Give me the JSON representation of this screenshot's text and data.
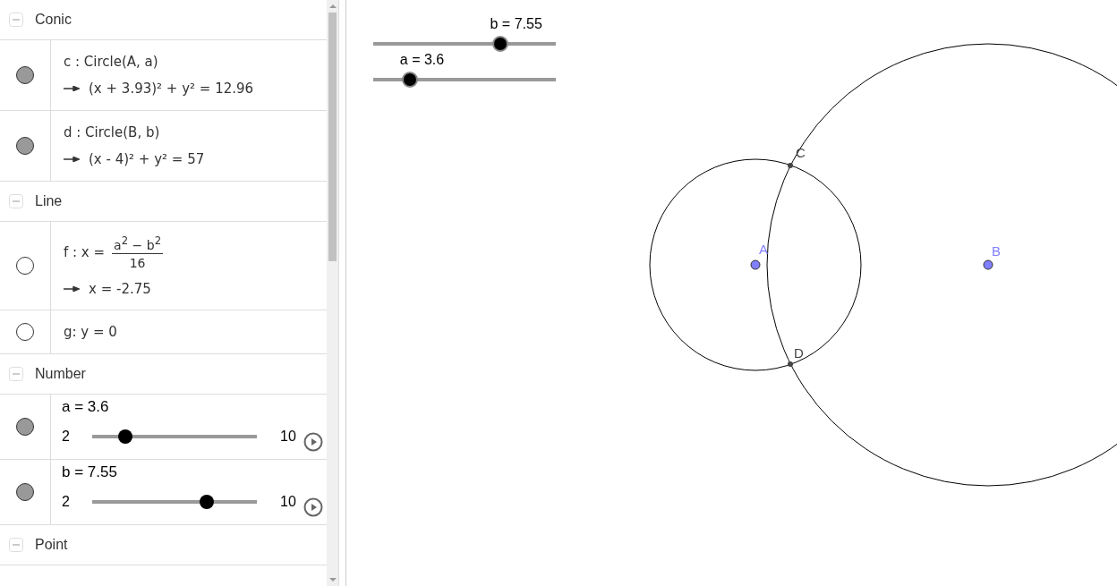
{
  "algebra": {
    "groups": [
      {
        "title": "Conic",
        "expanded": true,
        "items": [
          {
            "kind": "formula",
            "visible": true,
            "definition": "c : Circle(A, a)",
            "value": "(x + 3.93)² + y² = 12.96"
          },
          {
            "kind": "formula",
            "visible": true,
            "definition": "d : Circle(B, b)",
            "value": "(x - 4)² + y² = 57"
          }
        ]
      },
      {
        "title": "Line",
        "expanded": true,
        "items": [
          {
            "kind": "fraction",
            "visible": false,
            "definition": "f : x =",
            "numerator": "a$^{2}$ − b$^{2}$",
            "denominator": "16",
            "value": "x = -2.75"
          },
          {
            "kind": "plain",
            "visible": false,
            "definition": "g: y = 0"
          }
        ]
      },
      {
        "title": "Number",
        "expanded": true,
        "items": [
          {
            "kind": "slider",
            "visible": true,
            "label": "a = 3.6",
            "min": "2",
            "max": "10",
            "level": 0.2
          },
          {
            "kind": "slider",
            "visible": true,
            "label": "b = 7.55",
            "min": "2",
            "max": "10",
            "level": 0.69375
          }
        ]
      },
      {
        "title": "Point",
        "expanded": true
      }
    ]
  },
  "graphics": {
    "sliders": [
      {
        "label": "b = 7.55",
        "level": 0.69375
      },
      {
        "label": "a = 3.6",
        "level": 0.2
      }
    ],
    "points": [
      {
        "label": "A",
        "color": "#7f7fff"
      },
      {
        "label": "B",
        "color": "#7f7fff"
      },
      {
        "label": "C",
        "color": "#444444"
      },
      {
        "label": "D",
        "color": "#444444"
      }
    ]
  }
}
